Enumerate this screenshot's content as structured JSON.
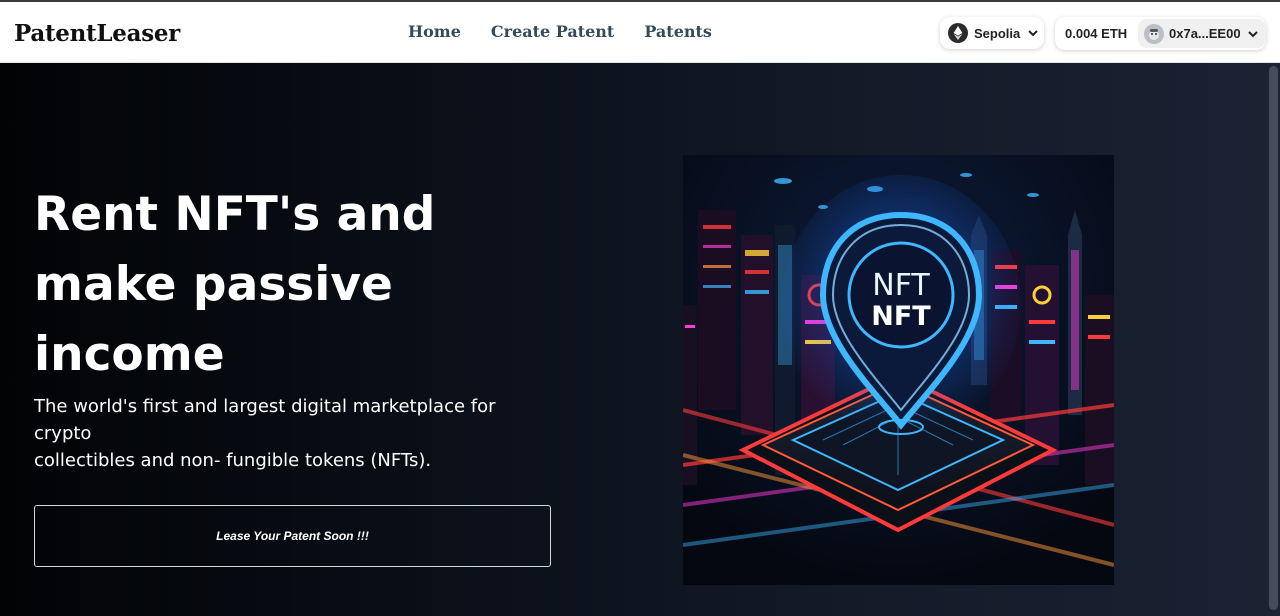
{
  "header": {
    "logo": "PatentLeaser",
    "nav": [
      "Home",
      "Create Patent",
      "Patents"
    ],
    "network": {
      "label": "Sepolia",
      "icon": "ethereum-icon"
    },
    "account": {
      "balance": "0.004 ETH",
      "address": "0x7a...EE00",
      "icon": "avatar-icon"
    }
  },
  "hero": {
    "headline_lines": [
      "Rent NFT's and",
      "make passive",
      "income"
    ],
    "subtext_lines": [
      "The world's first and largest digital marketplace for crypto",
      "collectibles and non- fungible tokens (NFTs)."
    ],
    "cta_label": "Lease Your Patent Soon !!!",
    "image": {
      "description_icon": "nft-city-illustration",
      "pin_text_top": "NFT",
      "pin_text_bottom": "NFT"
    }
  },
  "colors": {
    "nav_text": "#344b5c",
    "hero_bg_start": "#020305",
    "hero_bg_end": "#1a2233",
    "neon_blue": "#3fb7ff",
    "neon_red": "#ff3a3a",
    "neon_magenta": "#ff3ad9"
  }
}
